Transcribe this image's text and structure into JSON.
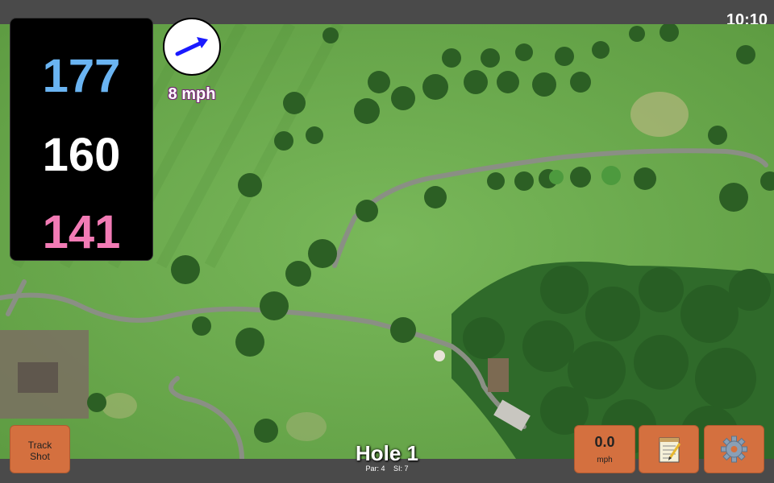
{
  "status": {
    "time": "10:10"
  },
  "yardages": {
    "back": "177",
    "middle": "160",
    "front": "141"
  },
  "wind": {
    "speed": "8 mph",
    "icon": "wind-arrow-icon",
    "color": "#1a1aff"
  },
  "hole": {
    "title": "Hole 1",
    "par": "Par: 4",
    "si": "SI: 7"
  },
  "buttons": {
    "track_shot": {
      "line1": "Track",
      "line2": "Shot"
    },
    "speed": {
      "value": "0.0",
      "unit": "mph"
    },
    "notes": {
      "icon": "notepad-icon"
    },
    "settings": {
      "icon": "gear-icon"
    }
  },
  "colors": {
    "back_yardage": "#6ab4f2",
    "middle_yardage": "#ffffff",
    "front_yardage": "#f27bb5",
    "button_bg": "#d4703f",
    "bar_bg": "#4a4a4a"
  }
}
